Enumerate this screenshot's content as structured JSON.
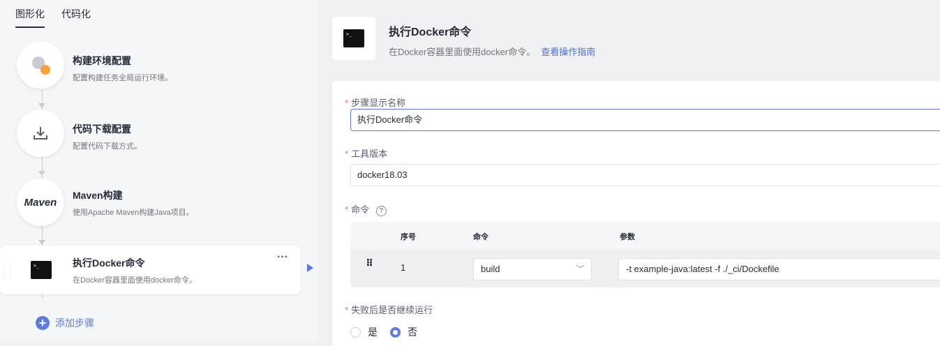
{
  "left": {
    "tabs": [
      {
        "label": "图形化"
      },
      {
        "label": "代码化"
      }
    ],
    "steps": [
      {
        "title": "构建环境配置",
        "desc": "配置构建任务全局运行环境。",
        "icon": "gear-icon"
      },
      {
        "title": "代码下载配置",
        "desc": "配置代码下载方式。",
        "icon": "download-icon"
      },
      {
        "title": "Maven构建",
        "desc": "使用Apache Maven构建Java项目。",
        "icon": "maven-logo",
        "logo_text": "Maven"
      },
      {
        "title": "执行Docker命令",
        "desc": "在Docker容器里面使用docker命令。",
        "icon": "terminal-icon",
        "more": "···"
      }
    ],
    "add_step": "添加步骤"
  },
  "header": {
    "title": "执行Docker命令",
    "desc": "在Docker容器里面使用docker命令。",
    "link": "查看操作指南",
    "terminal_text": ">_"
  },
  "form": {
    "name_label": "步骤显示名称",
    "name_value": "执行Docker命令",
    "version_label": "工具版本",
    "version_value": "docker18.03",
    "cmd_label": "命令",
    "help": "?",
    "table": {
      "headers": [
        "序号",
        "命令",
        "参数"
      ],
      "rows": [
        {
          "index": "1",
          "command": "build",
          "params": "-t example-java:latest -f ./_ci/Dockefile"
        }
      ]
    },
    "continue_label": "失败后是否继续运行",
    "options": [
      {
        "label": "是",
        "selected": false
      },
      {
        "label": "否",
        "selected": true
      }
    ]
  },
  "colors": {
    "accent": "#5e7ce0",
    "required": "#f66f6a"
  }
}
